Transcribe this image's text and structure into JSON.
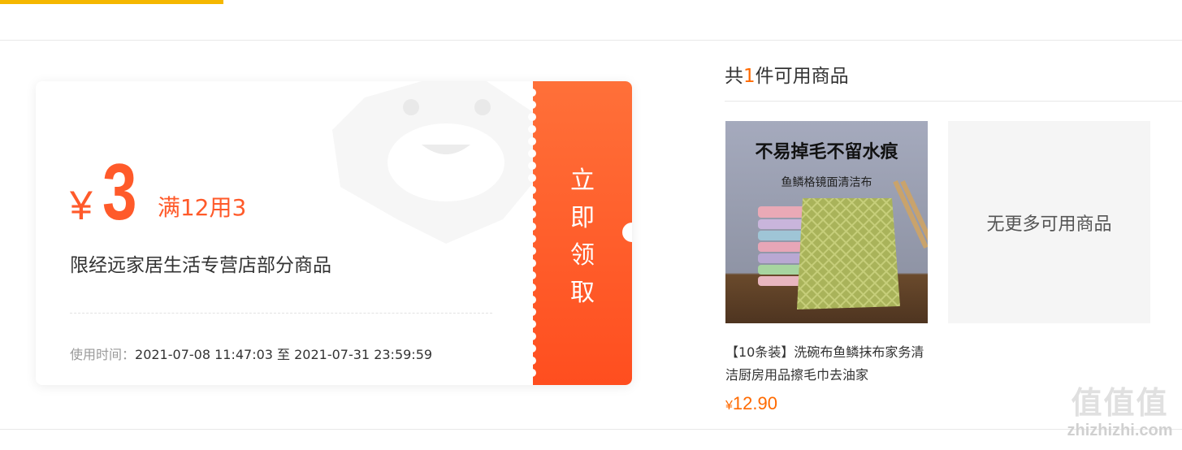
{
  "coupon": {
    "currency": "¥",
    "amount": "3",
    "threshold": "满12用3",
    "scope": "限经远家居生活专营店部分商品",
    "time_label": "使用时间：",
    "time_range": "2021-07-08 11:47:03 至 2021-07-31 23:59:59",
    "claim_label": "立即领取",
    "accent_color": "#ff5a2a"
  },
  "available": {
    "prefix": "共",
    "count": "1",
    "suffix": "件可用商品"
  },
  "product": {
    "image_headline": "不易掉毛不留水痕",
    "image_subline": "鱼鳞格镜面清洁布",
    "title": "【10条装】洗碗布鱼鳞抹布家务清洁厨房用品擦毛巾去油家",
    "price_currency": "¥",
    "price": "12.90"
  },
  "no_more_label": "无更多可用商品",
  "watermark": {
    "mark": "值值值",
    "text": "zhizhizhi.com"
  }
}
